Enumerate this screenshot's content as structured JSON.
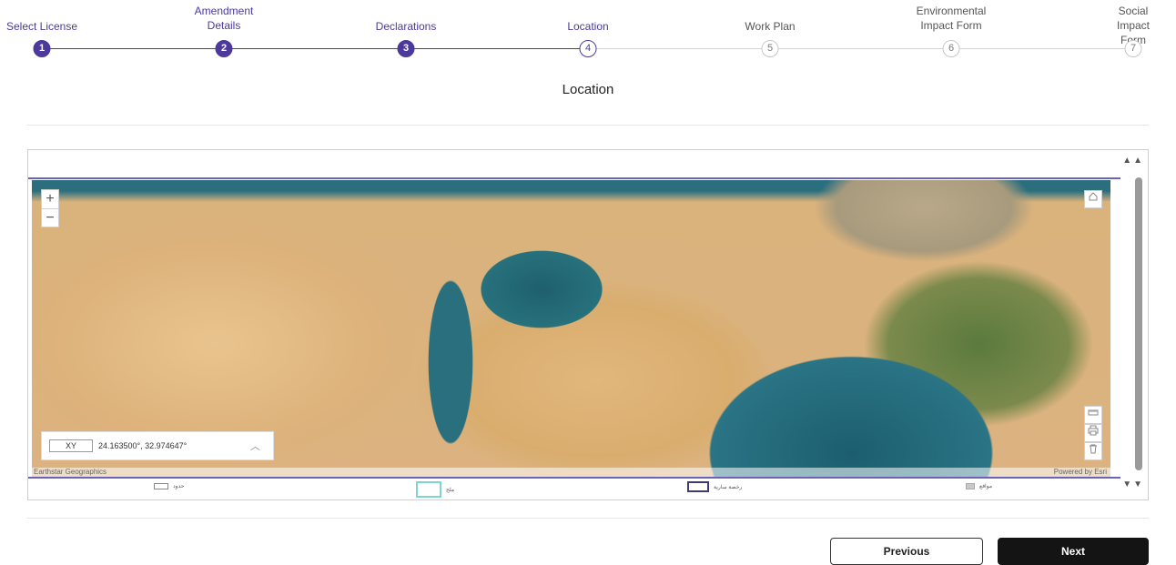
{
  "stepper": {
    "steps": [
      {
        "label": "Select License",
        "number": "1",
        "state": "done"
      },
      {
        "label": "Amendment\nDetails",
        "number": "2",
        "state": "done"
      },
      {
        "label": "Declarations",
        "number": "3",
        "state": "done"
      },
      {
        "label": "Location",
        "number": "4",
        "state": "current"
      },
      {
        "label": "Work Plan",
        "number": "5",
        "state": "todo"
      },
      {
        "label": "Environmental\nImpact Form",
        "number": "6",
        "state": "todo"
      },
      {
        "label": "Social\nImpact Form",
        "number": "7",
        "state": "todo"
      }
    ],
    "colors": {
      "active": "#4b3a9c",
      "inactive": "#c8c8c8"
    }
  },
  "page": {
    "title": "Location"
  },
  "map": {
    "zoom_in": "+",
    "zoom_out": "−",
    "coord_label": "XY",
    "coords": "24.163500°, 32.974647°",
    "attribution_left": "Earthstar Geographics",
    "attribution_right": "Powered by Esri",
    "icons": [
      "home-icon",
      "measure-icon",
      "print-icon",
      "trash-icon",
      "chevron-up-icon"
    ],
    "legend": [
      {
        "label": "حدود",
        "swatch": "outline-gray"
      },
      {
        "label": "ملح",
        "swatch": "outline-teal"
      },
      {
        "label": "رخصة سارية",
        "swatch": "outline-navy"
      },
      {
        "label": "مواقع",
        "swatch": "fill-gray"
      }
    ]
  },
  "actions": {
    "previous": "Previous",
    "next": "Next"
  }
}
